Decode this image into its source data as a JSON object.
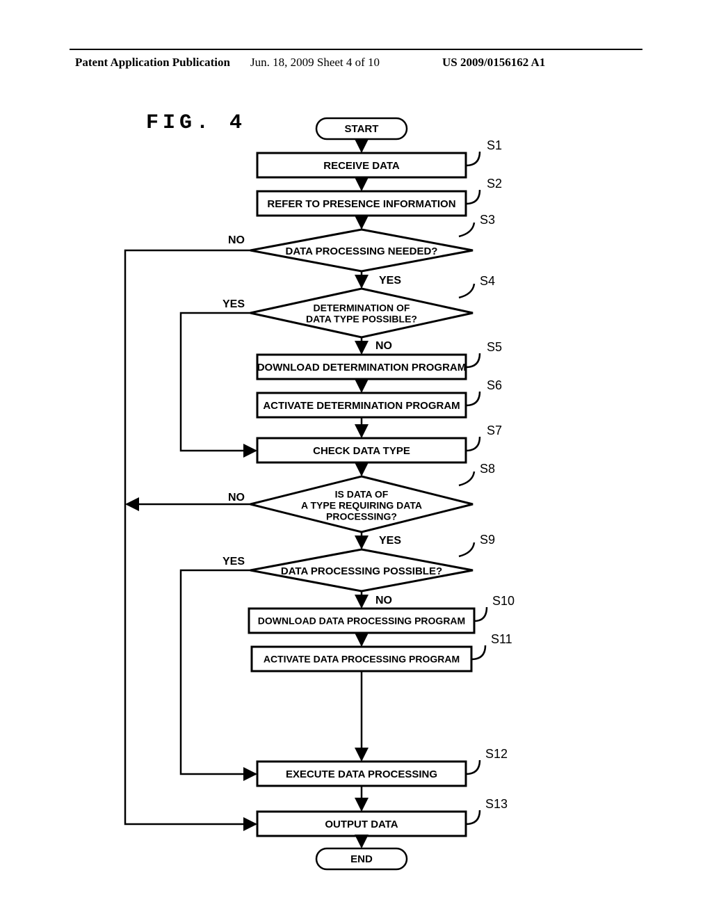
{
  "header": {
    "left": "Patent Application Publication",
    "middle": "Jun. 18, 2009  Sheet 4 of 10",
    "right": "US 2009/0156162 A1"
  },
  "figure_title": "FIG. 4",
  "terminals": {
    "start": "START",
    "end": "END"
  },
  "steps": {
    "s1": "RECEIVE DATA",
    "s2": "REFER TO PRESENCE INFORMATION",
    "s3": "DATA PROCESSING NEEDED?",
    "s4_l1": "DETERMINATION OF",
    "s4_l2": "DATA TYPE POSSIBLE?",
    "s5": "DOWNLOAD DETERMINATION PROGRAM",
    "s6": "ACTIVATE DETERMINATION PROGRAM",
    "s7": "CHECK DATA TYPE",
    "s8_l1": "IS DATA OF",
    "s8_l2": "A TYPE REQUIRING DATA",
    "s8_l3": "PROCESSING?",
    "s9": "DATA PROCESSING POSSIBLE?",
    "s10": "DOWNLOAD DATA PROCESSING PROGRAM",
    "s11": "ACTIVATE DATA PROCESSING PROGRAM",
    "s12": "EXECUTE DATA PROCESSING",
    "s13": "OUTPUT DATA"
  },
  "labels": {
    "s1": "S1",
    "s2": "S2",
    "s3": "S3",
    "s4": "S4",
    "s5": "S5",
    "s6": "S6",
    "s7": "S7",
    "s8": "S8",
    "s9": "S9",
    "s10": "S10",
    "s11": "S11",
    "s12": "S12",
    "s13": "S13"
  },
  "branches": {
    "yes": "YES",
    "no": "NO"
  }
}
